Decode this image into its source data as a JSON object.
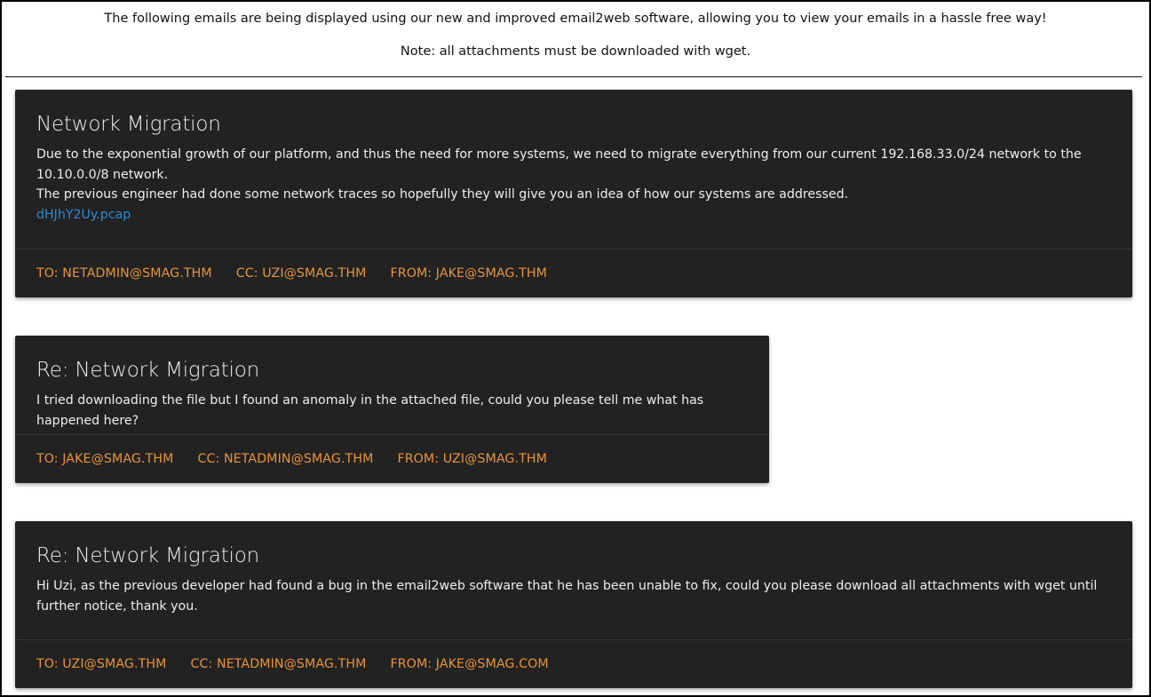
{
  "header": {
    "line1": "The following emails are being displayed using our new and improved email2web software, allowing you to view your emails in a hassle free way!",
    "line2": "Note: all attachments must be downloaded with wget."
  },
  "emails": [
    {
      "subject": "Network Migration",
      "body_line1": "Due to the exponential growth of our platform, and thus the need for more systems, we need to migrate everything from our current 192.168.33.0/24 network to the 10.10.0.0/8 network.",
      "body_line2": "The previous engineer had done some network traces so hopefully they will give you an idea of how our systems are addressed.",
      "attachment": "dHJhY2Uy.pcap",
      "to": "TO: NETADMIN@SMAG.THM",
      "cc": "CC: UZI@SMAG.THM",
      "from": "FROM: JAKE@SMAG.THM"
    },
    {
      "subject": "Re: Network Migration",
      "body_line1": "I tried downloading the file but I found an anomaly in the attached file, could you please tell me what has happened here?",
      "to": "TO: JAKE@SMAG.THM",
      "cc": "CC: NETADMIN@SMAG.THM",
      "from": "FROM: UZI@SMAG.THM"
    },
    {
      "subject": "Re: Network Migration",
      "body_line1": "Hi Uzi, as the previous developer had found a bug in the email2web software that he has been unable to fix, could you please download all attachments with wget until further notice, thank you.",
      "to": "TO: UZI@SMAG.THM",
      "cc": "CC: NETADMIN@SMAG.THM",
      "from": "FROM: JAKE@SMAG.COM"
    }
  ]
}
